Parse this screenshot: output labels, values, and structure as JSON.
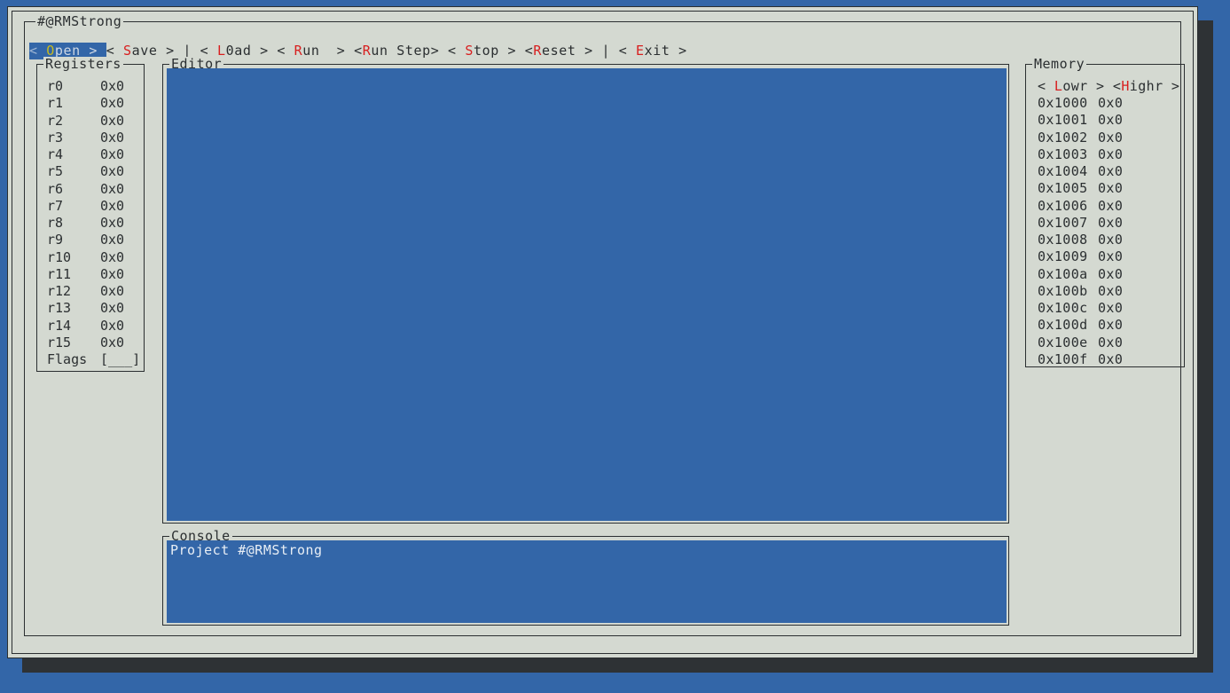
{
  "app": {
    "title": "#@RMStrong",
    "colors": {
      "desktop": "#3366a8",
      "window_bg": "#d4d9d1",
      "border": "#2b2f31",
      "shadow": "#2e3235",
      "accent_hot": "#d81f1f",
      "selection_bg": "#3366a8",
      "selection_hot": "#c8bb1e",
      "surface_blue": "#3366a8",
      "console_text": "#e8eef5"
    }
  },
  "menu": {
    "items": [
      {
        "name": "open",
        "pre": "< ",
        "hot": "O",
        "post": "pen > ",
        "selected": true
      },
      {
        "name": "save",
        "pre": "< ",
        "hot": "S",
        "post": "ave > ",
        "selected": false
      },
      {
        "name": "separator-1",
        "text": "| ",
        "separator": true
      },
      {
        "name": "load",
        "pre": "< ",
        "hot": "L",
        "post": "0ad > ",
        "selected": false
      },
      {
        "name": "run",
        "pre": "< ",
        "hot": "R",
        "post": "un  > ",
        "selected": false
      },
      {
        "name": "run-step",
        "pre": "<",
        "hot": "R",
        "post": "un Step> ",
        "selected": false
      },
      {
        "name": "stop",
        "pre": "< ",
        "hot": "S",
        "post": "top > ",
        "selected": false
      },
      {
        "name": "reset",
        "pre": "<",
        "hot": "R",
        "post": "eset > ",
        "selected": false
      },
      {
        "name": "separator-2",
        "text": "| ",
        "separator": true
      },
      {
        "name": "exit",
        "pre": "< ",
        "hot": "E",
        "post": "xit >",
        "selected": false
      }
    ]
  },
  "registers": {
    "legend": "Registers",
    "rows": [
      {
        "name": "r0",
        "value": "0x0"
      },
      {
        "name": "r1",
        "value": "0x0"
      },
      {
        "name": "r2",
        "value": "0x0"
      },
      {
        "name": "r3",
        "value": "0x0"
      },
      {
        "name": "r4",
        "value": "0x0"
      },
      {
        "name": "r5",
        "value": "0x0"
      },
      {
        "name": "r6",
        "value": "0x0"
      },
      {
        "name": "r7",
        "value": "0x0"
      },
      {
        "name": "r8",
        "value": "0x0"
      },
      {
        "name": "r9",
        "value": "0x0"
      },
      {
        "name": "r10",
        "value": "0x0"
      },
      {
        "name": "r11",
        "value": "0x0"
      },
      {
        "name": "r12",
        "value": "0x0"
      },
      {
        "name": "r13",
        "value": "0x0"
      },
      {
        "name": "r14",
        "value": "0x0"
      },
      {
        "name": "r15",
        "value": "0x0"
      }
    ],
    "flags_label": "Flags",
    "flags_value": "[___]"
  },
  "editor": {
    "legend": "Editor",
    "content": ""
  },
  "console": {
    "legend": "Console",
    "lines": [
      "Project #@RMStrong"
    ]
  },
  "memory": {
    "legend": "Memory",
    "lower_button": {
      "pre": "< ",
      "hot": "L",
      "post": "owr > "
    },
    "higher_button": {
      "pre": "<",
      "hot": "H",
      "post": "ighr >"
    },
    "rows": [
      {
        "address": "0x1000",
        "value": "0x0"
      },
      {
        "address": "0x1001",
        "value": "0x0"
      },
      {
        "address": "0x1002",
        "value": "0x0"
      },
      {
        "address": "0x1003",
        "value": "0x0"
      },
      {
        "address": "0x1004",
        "value": "0x0"
      },
      {
        "address": "0x1005",
        "value": "0x0"
      },
      {
        "address": "0x1006",
        "value": "0x0"
      },
      {
        "address": "0x1007",
        "value": "0x0"
      },
      {
        "address": "0x1008",
        "value": "0x0"
      },
      {
        "address": "0x1009",
        "value": "0x0"
      },
      {
        "address": "0x100a",
        "value": "0x0"
      },
      {
        "address": "0x100b",
        "value": "0x0"
      },
      {
        "address": "0x100c",
        "value": "0x0"
      },
      {
        "address": "0x100d",
        "value": "0x0"
      },
      {
        "address": "0x100e",
        "value": "0x0"
      },
      {
        "address": "0x100f",
        "value": "0x0"
      }
    ]
  }
}
